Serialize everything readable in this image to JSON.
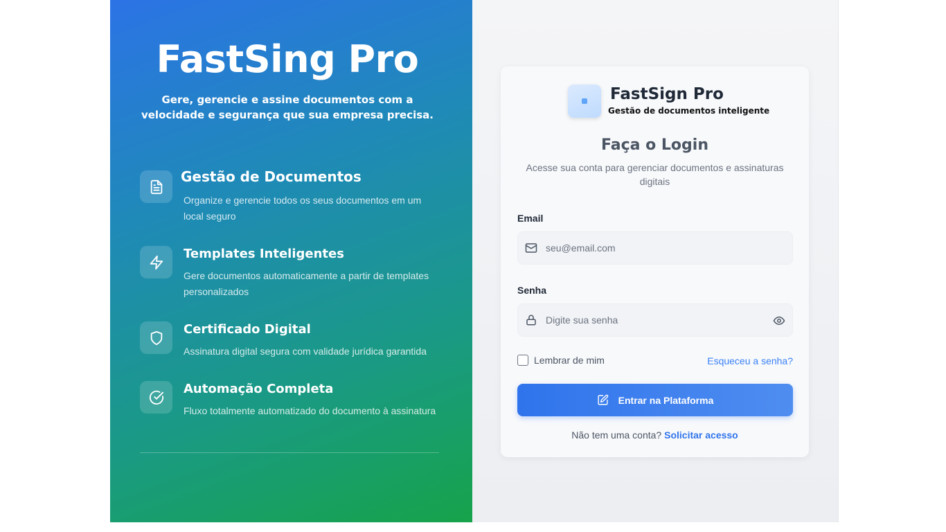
{
  "hero": {
    "title": "FastSing Pro",
    "subtitle_line1": "Gere, gerencie e assine documentos com a",
    "subtitle_line2": "velocidade e segurança que sua empresa precisa."
  },
  "features": [
    {
      "title": "Gestão de Documentos",
      "icon": "document-icon",
      "desc_line1": "Organize e gerencie todos os seus documentos em um",
      "desc_line2": "local seguro"
    },
    {
      "title": "Templates Inteligentes",
      "icon": "lightning-icon",
      "desc_line1": "Gere documentos automaticamente a partir de templates",
      "desc_line2": "personalizados"
    },
    {
      "title": "Certificado Digital",
      "icon": "shield-icon",
      "desc_line1": "Assinatura digital segura com validade jurídica garantida",
      "desc_line2": ""
    },
    {
      "title": "Automação Completa",
      "icon": "check-circle-icon",
      "desc_line1": "Fluxo totalmente automatizado do documento à assinatura",
      "desc_line2": ""
    }
  ],
  "login": {
    "app_name": "FastSign Pro",
    "app_tagline": "Gestão de documentos inteligente",
    "title": "Faça o Login",
    "subtitle_line1": "Acesse sua conta para gerenciar documentos e assinaturas",
    "subtitle_line2": "digitais",
    "email_label": "Email",
    "email_placeholder": "seu@email.com",
    "password_label": "Senha",
    "password_placeholder": "Digite sua senha",
    "remember_label": "Lembrar de mim",
    "forgot_link": "Esqueceu a senha?",
    "submit_label": "Entrar na Plataforma",
    "signup_prompt": "Não tem uma conta?",
    "signup_link": "Solicitar acesso"
  },
  "colors": {
    "accent": "#2f74ec",
    "gradient_start": "#2c73e6",
    "gradient_end": "#16a34a"
  }
}
